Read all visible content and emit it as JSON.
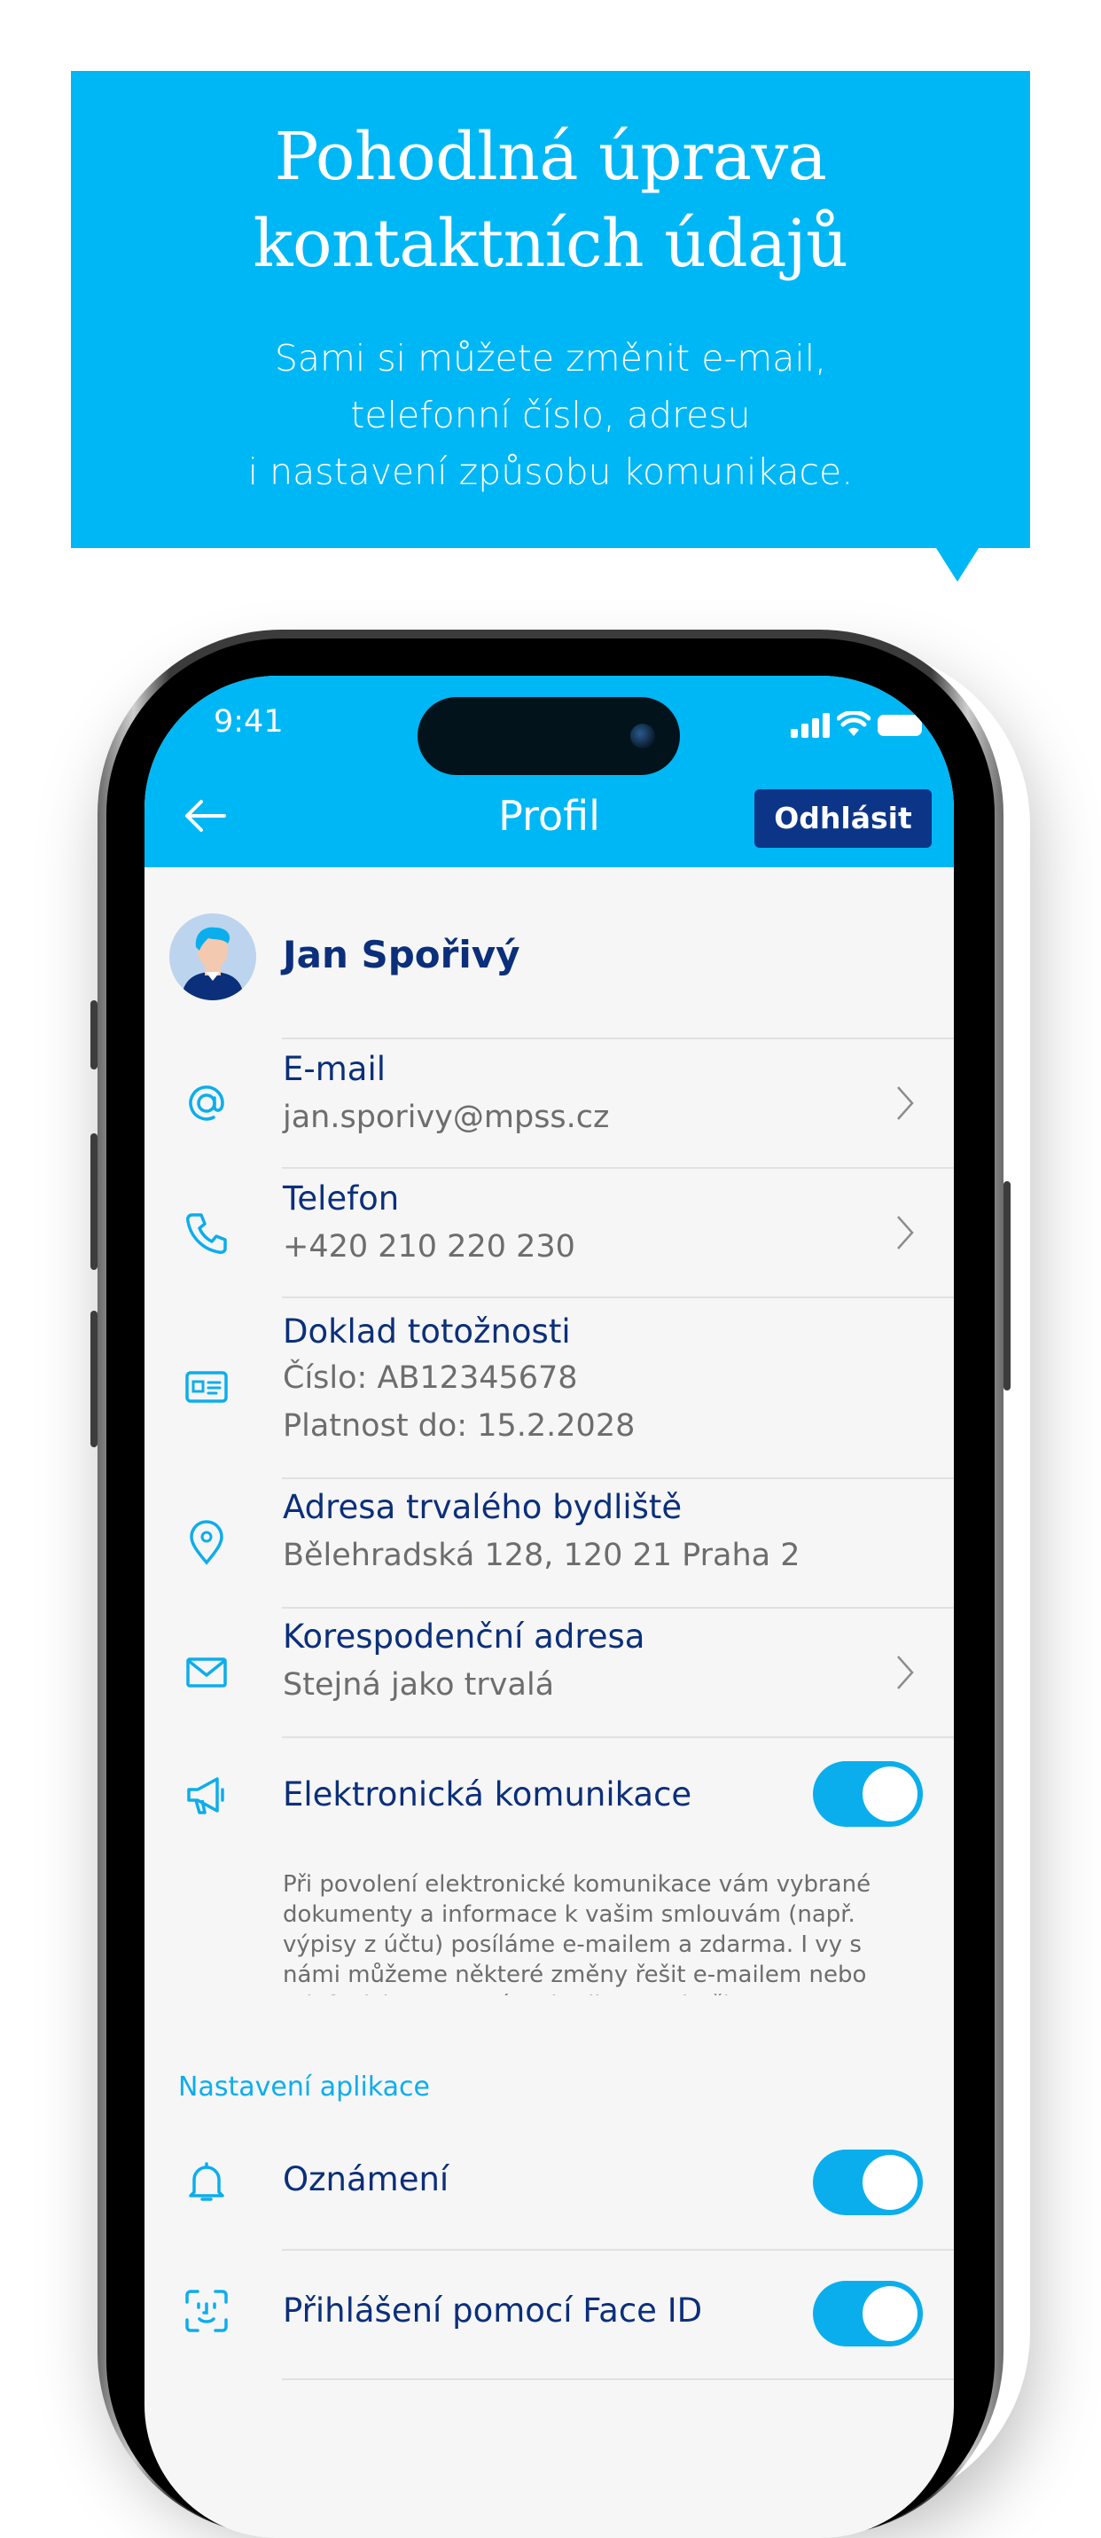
{
  "banner": {
    "title_line1": "Pohodlná úprava",
    "title_line2": "kontaktních údajů",
    "subtitle_line1": "Sami si můžete změnit e-mail,",
    "subtitle_line2": "telefonní číslo, adresu",
    "subtitle_line3": "i nastavení způsobu komunikace."
  },
  "status_bar": {
    "time": "9:41",
    "icons": [
      "signal-icon",
      "wifi-icon",
      "battery-icon"
    ]
  },
  "header": {
    "back_icon": "arrow-left-icon",
    "title": "Profil",
    "logout_label": "Odhlásit"
  },
  "profile": {
    "name": "Jan Spořivý"
  },
  "contacts": [
    {
      "label": "E-mail",
      "value": "jan.sporivy@mpss.cz",
      "icon": "at-icon"
    },
    {
      "label": "Telefon",
      "value": "+420 210 220 230",
      "icon": "phone-icon"
    },
    {
      "label": "Doklad totožnosti",
      "value": "Číslo: AB12345678",
      "value2": "Platnost do: 15.2.2028",
      "icon": "id-card-icon"
    },
    {
      "label": "Adresa trvalého bydliště",
      "value": "Bělehradská 128, 120 21 Praha 2",
      "icon": "location-pin-icon"
    },
    {
      "label": "Korespodenční adresa",
      "value": "Stejná jako trvalá",
      "icon": "envelope-icon"
    }
  ],
  "communication": {
    "label": "Elektronická komunikace",
    "icon": "megaphone-icon",
    "enabled": true,
    "info": "Při povolení elektronické komunikace vám vybrané dokumenty a informace k vašim smlouvám (např. výpisy z účtu) posíláme e-mailem a zdarma. I vy s námi můžeme některé změny řešit e-mailem nebo telefonicky, nemusíte chodit na pobočku."
  },
  "app_settings": {
    "section_title": "Nastavení aplikace",
    "items": [
      {
        "label": "Oznámení",
        "icon": "bell-icon",
        "enabled": true
      },
      {
        "label": "Přihlášení pomocí Face ID",
        "icon": "face-id-icon",
        "enabled": true
      }
    ]
  },
  "colors": {
    "accent": "#00b7f5",
    "navy": "#0c3588",
    "text_primary": "#0b2f7a",
    "text_secondary": "#6d6d6d"
  }
}
